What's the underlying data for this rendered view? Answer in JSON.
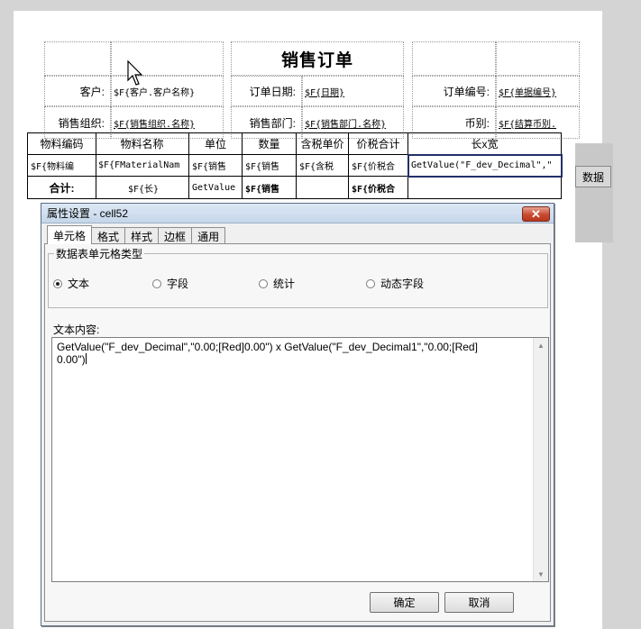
{
  "report": {
    "title": "销售订单",
    "fields": {
      "customer_label": "客户:",
      "customer_value": "$F{客户.客户名称}",
      "order_date_label": "订单日期:",
      "order_date_value": "$F{日期}",
      "order_no_label": "订单编号:",
      "order_no_value": "$F{单据编号}",
      "sales_org_label": "销售组织:",
      "sales_org_value": "$F{销售组织.名称}",
      "sales_dept_label": "销售部门:",
      "sales_dept_value": "$F{销售部门.名称}",
      "currency_label": "币别:",
      "currency_value": "$F{结算币别."
    },
    "table": {
      "headers": [
        "物料编码",
        "物料名称",
        "单位",
        "数量",
        "含税单价",
        "价税合计",
        "长x宽"
      ],
      "detail_row": [
        "$F{物料编",
        "$F{FMaterialNam",
        "$F{销售",
        "$F{销售",
        "$F{含税",
        "$F{价税合",
        "GetValue(\"F_dev_Decimal\",\""
      ],
      "total_row": [
        "合计:",
        "$F{长}",
        "GetValue",
        "$F{销售",
        "",
        "$F{价税合",
        ""
      ]
    },
    "side_label": "数据"
  },
  "dialog": {
    "title": "属性设置 - cell52",
    "close_label": "✕",
    "tabs": [
      "单元格",
      "格式",
      "样式",
      "边框",
      "通用"
    ],
    "group_title": "数据表单元格类型",
    "options": [
      {
        "label": "文本",
        "checked": true
      },
      {
        "label": "字段",
        "checked": false
      },
      {
        "label": "统计",
        "checked": false
      },
      {
        "label": "动态字段",
        "checked": false
      }
    ],
    "text_label": "文本内容:",
    "text_value": "GetValue(\"F_dev_Decimal\",\"0.00;[Red]0.00\") x GetValue(\"F_dev_Decimal1\",\"0.00;[Red]\n0.00\")",
    "ok_label": "确定",
    "cancel_label": "取消"
  }
}
